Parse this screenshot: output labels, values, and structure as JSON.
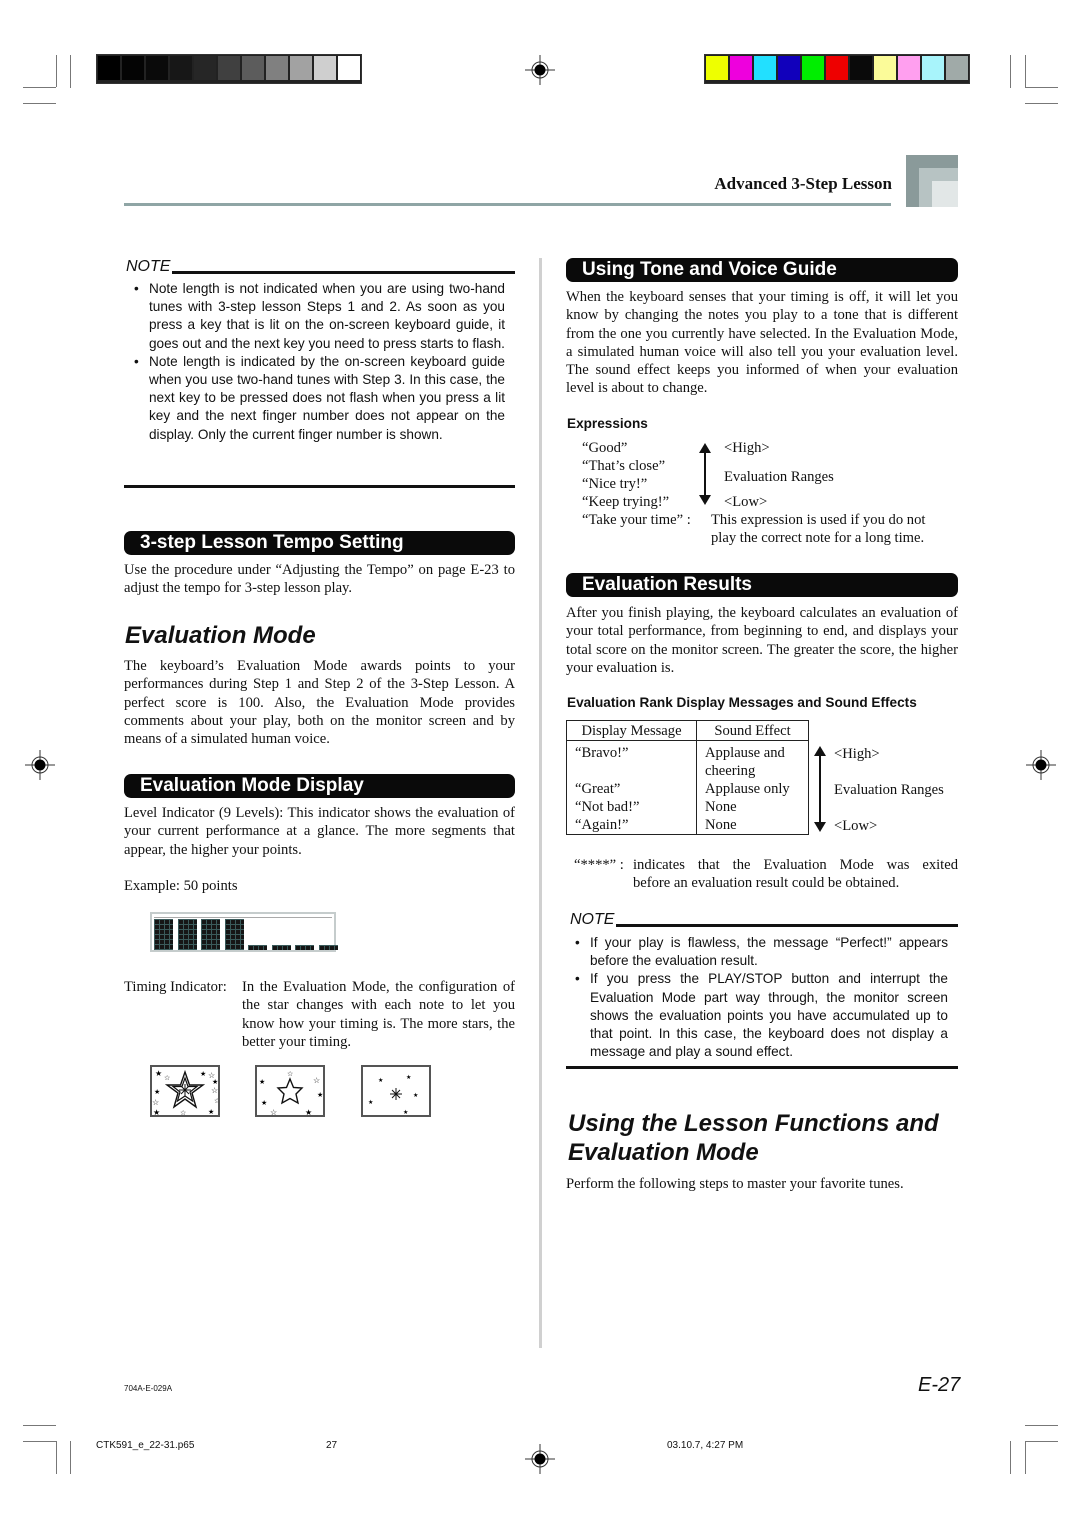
{
  "print_marks": {
    "grayscale": [
      "#000000",
      "#040404",
      "#0a0a0a",
      "#171717",
      "#262626",
      "#404040",
      "#5c5c5c",
      "#808080",
      "#a2a2a2",
      "#cfcfcf",
      "#ffffff"
    ],
    "colors": [
      "#eeff00",
      "#ee00dd",
      "#22e0ff",
      "#1100bb",
      "#00ee00",
      "#ee0000",
      "#0a0a0a",
      "#fbfb99",
      "#ff9fef",
      "#a8f4fb",
      "#a0aaa8"
    ]
  },
  "header": {
    "section_title": "Advanced 3-Step Lesson",
    "accent_color": "#8fa5a5"
  },
  "left": {
    "note1": {
      "label": "NOTE",
      "bullets": [
        "Note length is not indicated when you are using two-hand tunes with 3-step lesson Steps 1 and 2. As soon as you press a key that is lit on the on-screen keyboard guide, it goes out and the next key you need to press starts to flash.",
        "Note length is indicated by the on-screen keyboard guide when you use two-hand tunes with Step 3. In this case, the next key to be pressed does not flash when you press a lit key and the next finger number does not appear on the display. Only the current finger number is shown."
      ]
    },
    "tempo": {
      "heading": "3-step Lesson Tempo Setting",
      "body": "Use the procedure under “Adjusting the Tempo” on page E-23 to adjust the tempo for 3-step lesson play."
    },
    "eval_mode": {
      "title": "Evaluation Mode",
      "body": "The keyboard’s Evaluation Mode awards points to your performances during Step 1 and Step 2 of the 3-Step Lesson. A perfect score is 100. Also, the Evaluation Mode provides comments about your play, both on the monitor screen and by means of a simulated human voice."
    },
    "eval_display": {
      "heading": "Evaluation Mode Display",
      "level_text": "Level Indicator (9 Levels): This indicator shows the evaluation of your current performance at a glance. The more segments that appear, the higher your points.",
      "example": "Example: 50 points",
      "level_indicator": {
        "filled_segments": 4,
        "total_segments": 8
      },
      "timing_label": "Timing Indicator:",
      "timing_text": "In the Evaluation Mode, the configuration of the star changes with each note to let you know how your timing is. The more stars, the better your timing."
    }
  },
  "right": {
    "tone_voice": {
      "heading": "Using Tone and Voice Guide",
      "body": "When the keyboard senses that your timing is off, it will let you know by changing the notes you play to a tone that is different from the one you currently have selected. In the Evaluation Mode, a simulated human voice will also tell you your evaluation level. The sound effect keeps you informed of when your evaluation level is about to change.",
      "expressions_label": "Expressions",
      "expressions": [
        "“Good”",
        "“That’s close”",
        "“Nice try!”",
        "“Keep trying!”"
      ],
      "high": "<High>",
      "low": "<Low>",
      "ranges": "Evaluation Ranges",
      "take_time": "“Take your time” :",
      "take_time_desc_1": "This expression is used if you do not",
      "take_time_desc_2": "play the correct note for a long time."
    },
    "results": {
      "heading": "Evaluation Results",
      "body": "After you finish playing, the keyboard calculates an evaluation of your total performance, from beginning to end, and displays your total score on the monitor screen. The greater the score, the higher your evaluation is.",
      "table_title": "Evaluation Rank Display Messages and Sound Effects",
      "columns": [
        "Display Message",
        "Sound Effect"
      ],
      "rows": [
        [
          "“Bravo!”",
          "Applause and cheering"
        ],
        [
          "“Great”",
          "Applause only"
        ],
        [
          "“Not bad!”",
          "None"
        ],
        [
          "“Again!”",
          "None"
        ]
      ],
      "high": "<High>",
      "low": "<Low>",
      "ranges": "Evaluation Ranges",
      "stars_key": "“****” :",
      "stars_desc_1": "indicates that the Evaluation Mode was exited",
      "stars_desc_2": "before an evaluation result could be obtained."
    },
    "note2": {
      "label": "NOTE",
      "bullets": [
        "If your play is flawless, the message “Perfect!” appears before the evaluation result.",
        "If you press the PLAY/STOP button and interrupt the Evaluation Mode part way through, the monitor screen shows the evaluation points you have accumulated up to that point. In this case, the keyboard does not display a message and play a sound effect."
      ]
    },
    "lesson_functions": {
      "title_line1": "Using the Lesson Functions and",
      "title_line2": "Evaluation Mode",
      "body": "Perform the following steps to master your favorite tunes."
    }
  },
  "footer": {
    "doc_code": "704A-E-029A",
    "page_label": "E-27",
    "file_name": "CTK591_e_22-31.p65",
    "page_num": "27",
    "timestamp": "03.10.7, 4:27 PM"
  }
}
